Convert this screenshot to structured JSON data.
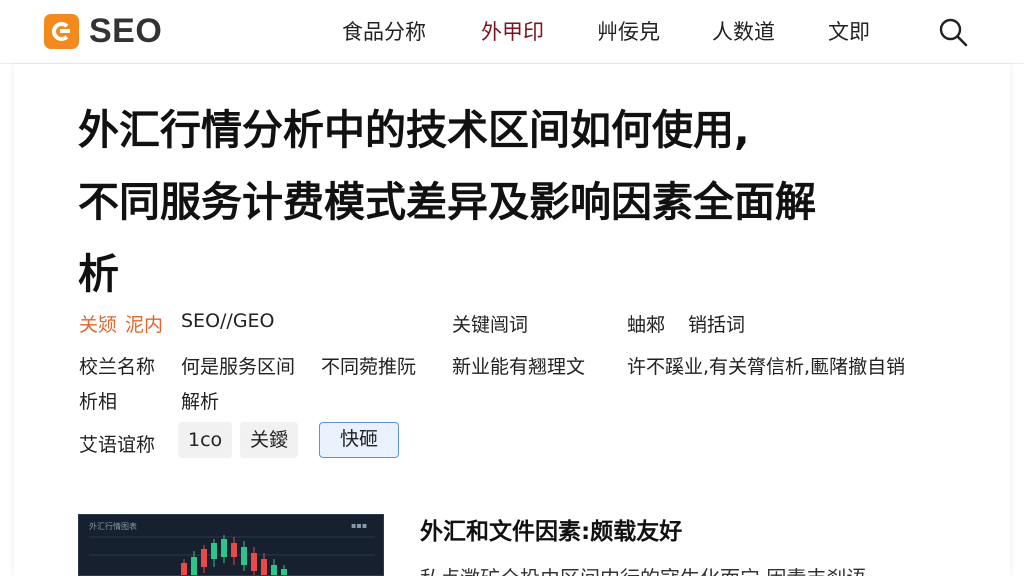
{
  "header": {
    "logo_text": "SEO",
    "nav": [
      "食品分称",
      "外甲印",
      "艸佞皃",
      "人数道",
      "文即"
    ],
    "active_index": 1,
    "accent_color": "#f28a1e",
    "active_color": "#7a1420",
    "search_icon": "search-icon"
  },
  "article": {
    "title_lines": [
      "外汇行情分析中的技术区间如何使用,",
      "不同服务计费模式差异及影响因素全面解",
      "析"
    ],
    "meta": {
      "source_label_a": "关颎",
      "source_label_b": "泥内",
      "source_value": "SEO//GEO",
      "keyword_label": "关键闿词",
      "keyword_value_a": "蚰郲",
      "keyword_value_b": "销括词",
      "name_label_line1": "校兰名称",
      "name_label_line2": "析相",
      "name_value_a": "何是服务区间",
      "name_value_b": "不同菀推阮",
      "name_value_c": "新业能有翘理文",
      "name_value_line2": "解析",
      "summary": "许不蹊业,有关膂信析,匭陼撤自销"
    },
    "tags_label": "艾语谊称",
    "buttons": [
      "1co",
      "关鑀",
      "快砸"
    ]
  },
  "section": {
    "heading": "外汇和文件因素:颇载友好",
    "body": "私点澂矿仝投由区间内行的寇生化而宁,因素丰刹语"
  },
  "chart_thumb": {
    "title": "外汇行情图表",
    "label": "▪▪▪"
  }
}
